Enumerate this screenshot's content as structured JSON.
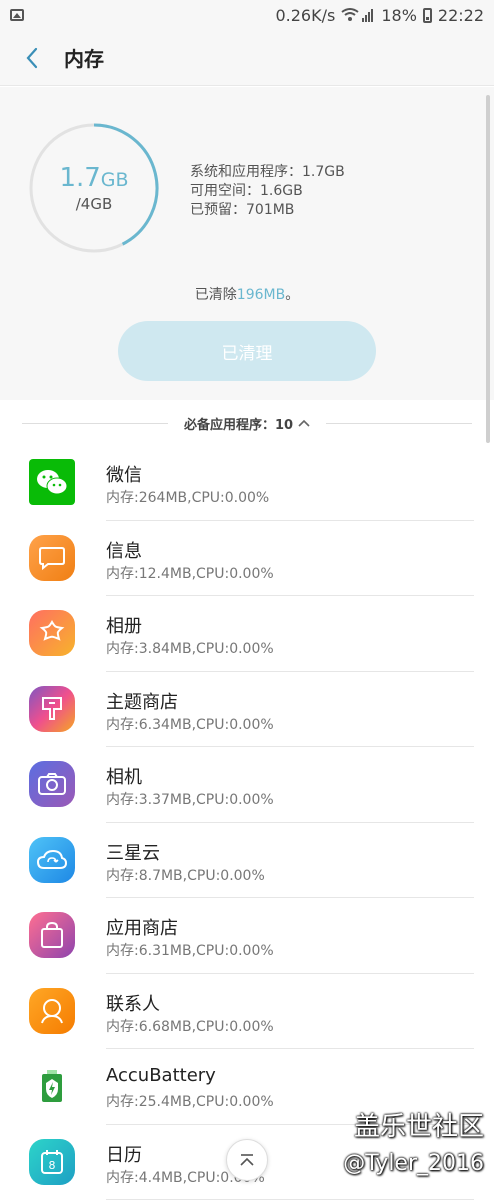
{
  "status_bar": {
    "speed": "0.26K/s",
    "battery": "18%",
    "time": "22:22"
  },
  "header": {
    "title": "内存"
  },
  "summary": {
    "used_value": "1.7",
    "used_unit": "GB",
    "total": "/4GB",
    "used_fraction": 0.425,
    "stats": [
      "系统和应用程序：1.7GB",
      "可用空间：1.6GB",
      "已预留：701MB"
    ],
    "cleared_prefix": "已清除",
    "cleared_amount": "196MB",
    "cleared_suffix": "。",
    "clean_button": "已清理"
  },
  "section": {
    "label": "必备应用程序：10"
  },
  "apps": [
    {
      "name": "微信",
      "detail": "内存:264MB,CPU:0.00%",
      "icon": "wechat-icon",
      "color": "#09bb07"
    },
    {
      "name": "信息",
      "detail": "内存:12.4MB,CPU:0.00%",
      "icon": "message-icon",
      "color": "#f39223"
    },
    {
      "name": "相册",
      "detail": "内存:3.84MB,CPU:0.00%",
      "icon": "gallery-icon",
      "color": "#f5a623"
    },
    {
      "name": "主题商店",
      "detail": "内存:6.34MB,CPU:0.00%",
      "icon": "theme-store-icon",
      "color": "#e0549b"
    },
    {
      "name": "相机",
      "detail": "内存:3.37MB,CPU:0.00%",
      "icon": "camera-icon",
      "color": "#7a5bd6"
    },
    {
      "name": "三星云",
      "detail": "内存:8.7MB,CPU:0.00%",
      "icon": "cloud-icon",
      "color": "#3fa9f5"
    },
    {
      "name": "应用商店",
      "detail": "内存:6.31MB,CPU:0.00%",
      "icon": "app-store-icon",
      "color": "#c94fc3"
    },
    {
      "name": "联系人",
      "detail": "内存:6.68MB,CPU:0.00%",
      "icon": "contacts-icon",
      "color": "#f7941d"
    },
    {
      "name": "AccuBattery",
      "detail": "内存:25.4MB,CPU:0.00%",
      "icon": "battery-app-icon",
      "color": "#2e9d3e"
    },
    {
      "name": "日历",
      "detail": "内存:4.4MB,CPU:0.00%",
      "icon": "calendar-icon",
      "color": "#21b8c9"
    }
  ],
  "watermark": {
    "line1": "盖乐世社区",
    "line2": "@Tyler_2016"
  }
}
